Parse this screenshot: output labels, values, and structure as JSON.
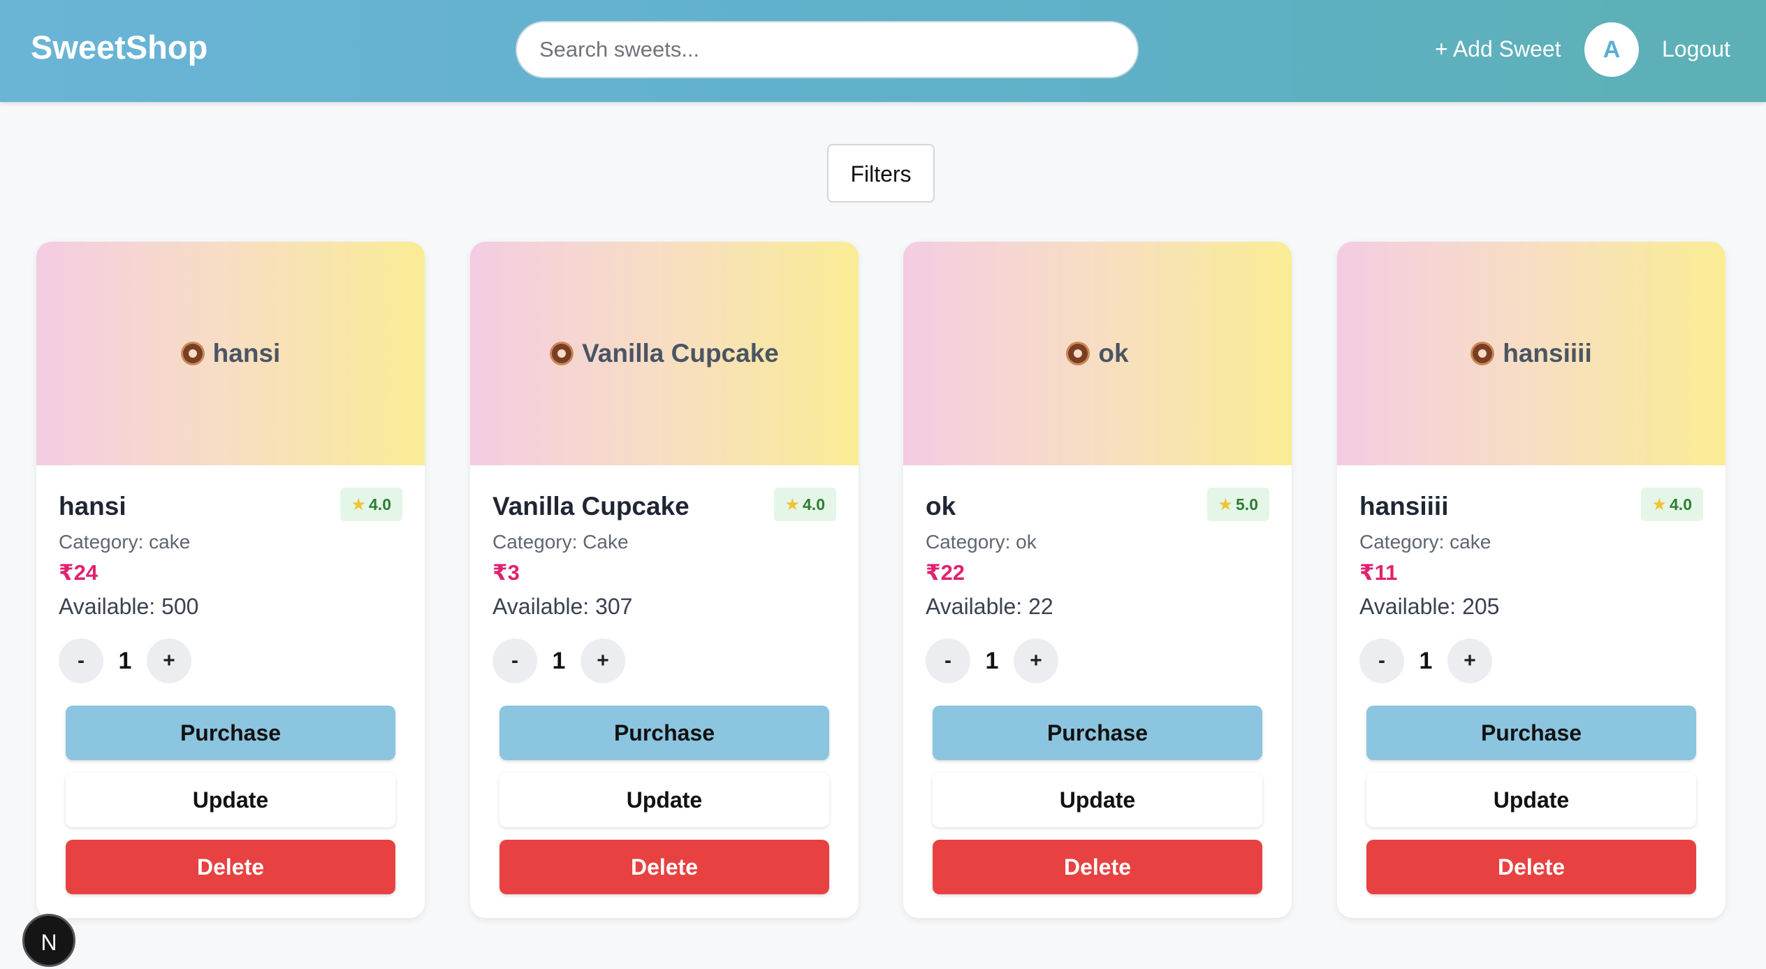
{
  "header": {
    "brand": "SweetShop",
    "search_placeholder": "Search sweets...",
    "add_sweet_label": "+ Add Sweet",
    "avatar_initial": "A",
    "logout_label": "Logout"
  },
  "filters_label": "Filters",
  "labels": {
    "purchase": "Purchase",
    "update": "Update",
    "delete": "Delete",
    "minus": "-",
    "plus": "+"
  },
  "cards": [
    {
      "banner": "hansi",
      "name": "hansi",
      "rating": "4.0",
      "category": "Category: cake",
      "price": "₹24",
      "available": "Available: 500",
      "qty": "1"
    },
    {
      "banner": "Vanilla Cupcake",
      "name": "Vanilla Cupcake",
      "rating": "4.0",
      "category": "Category: Cake",
      "price": "₹3",
      "available": "Available: 307",
      "qty": "1"
    },
    {
      "banner": "ok",
      "name": "ok",
      "rating": "5.0",
      "category": "Category: ok",
      "price": "₹22",
      "available": "Available: 22",
      "qty": "1"
    },
    {
      "banner": "hansiiii",
      "name": "hansiiii",
      "rating": "4.0",
      "category": "Category: cake",
      "price": "₹11",
      "available": "Available: 205",
      "qty": "1"
    }
  ],
  "next_badge": "N",
  "colors": {
    "header_gradient_start": "#6ab4d6",
    "header_gradient_end": "#5db0b4",
    "purchase": "#8bc5df",
    "delete": "#e84141",
    "price": "#e0226e",
    "rating_bg": "#e3f6e7"
  }
}
